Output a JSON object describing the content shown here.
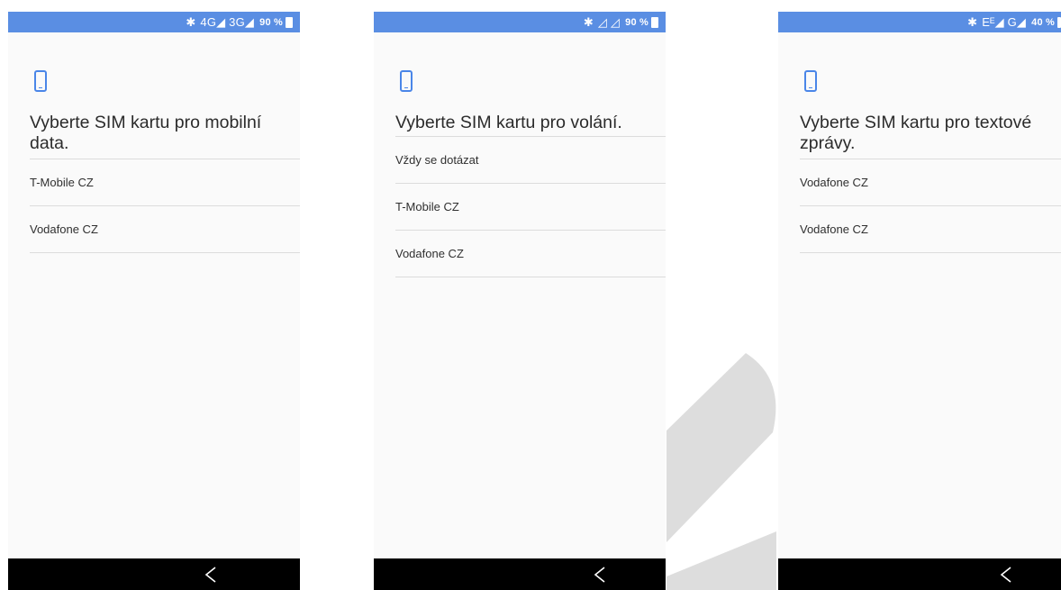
{
  "colors": {
    "accent": "#4a86e8",
    "status_bar": "#5a8ee3",
    "nav_bar": "#000000",
    "divider": "#dcdcdc",
    "background": "#fafafa"
  },
  "icons": {
    "sim_icon": "phone-icon",
    "back": "back-icon",
    "bluetooth": "bluetooth-icon",
    "battery": "battery-icon"
  },
  "screens": [
    {
      "status": {
        "bluetooth": "✱",
        "network": "4G◢ 3G◢",
        "battery": "90 %"
      },
      "title": "Vyberte SIM kartu pro mobilní data.",
      "items": [
        "T-Mobile CZ",
        "Vodafone CZ"
      ]
    },
    {
      "status": {
        "bluetooth": "✱",
        "network": "◿ ◿",
        "battery": "90 %"
      },
      "title": "Vyberte SIM kartu pro volání.",
      "items": [
        "Vždy se dotázat",
        "T-Mobile CZ",
        "Vodafone CZ"
      ]
    },
    {
      "status": {
        "bluetooth": "✱",
        "network": "Eᴱ◢ G◢",
        "battery": "40 %"
      },
      "title": "Vyberte SIM kartu pro textové zprávy.",
      "items": [
        "Vodafone CZ",
        "Vodafone CZ"
      ]
    }
  ]
}
